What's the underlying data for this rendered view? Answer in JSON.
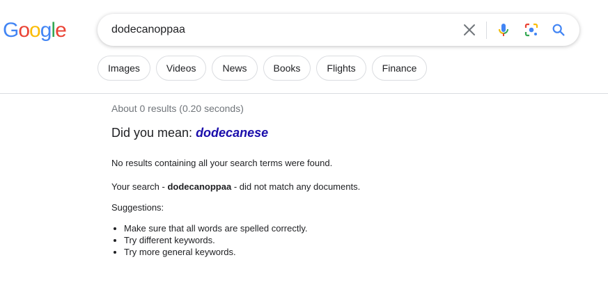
{
  "logo": {
    "letters": [
      "G",
      "o",
      "o",
      "g",
      "l",
      "e"
    ],
    "colors": [
      "#4285f4",
      "#ea4335",
      "#fbbc05",
      "#4285f4",
      "#34a853",
      "#ea4335"
    ]
  },
  "search": {
    "value": "dodecanoppaa",
    "icons": [
      "clear-icon",
      "mic-icon",
      "lens-icon",
      "search-icon"
    ]
  },
  "tabs": [
    "Images",
    "Videos",
    "News",
    "Books",
    "Flights",
    "Finance"
  ],
  "results": {
    "stats": "About 0 results (0.20 seconds)",
    "did_you_mean_prefix": "Did you mean: ",
    "did_you_mean_term": "dodecanese",
    "no_results": "No results containing all your search terms were found.",
    "your_search_prefix": "Your search - ",
    "your_search_term": "dodecanoppaa",
    "your_search_suffix": " - did not match any documents.",
    "suggestions_label": "Suggestions:",
    "suggestions": [
      "Make sure that all words are spelled correctly.",
      "Try different keywords.",
      "Try more general keywords."
    ]
  },
  "colors": {
    "link": "#1a0dab",
    "muted": "#70757a",
    "border": "#dadce0"
  }
}
